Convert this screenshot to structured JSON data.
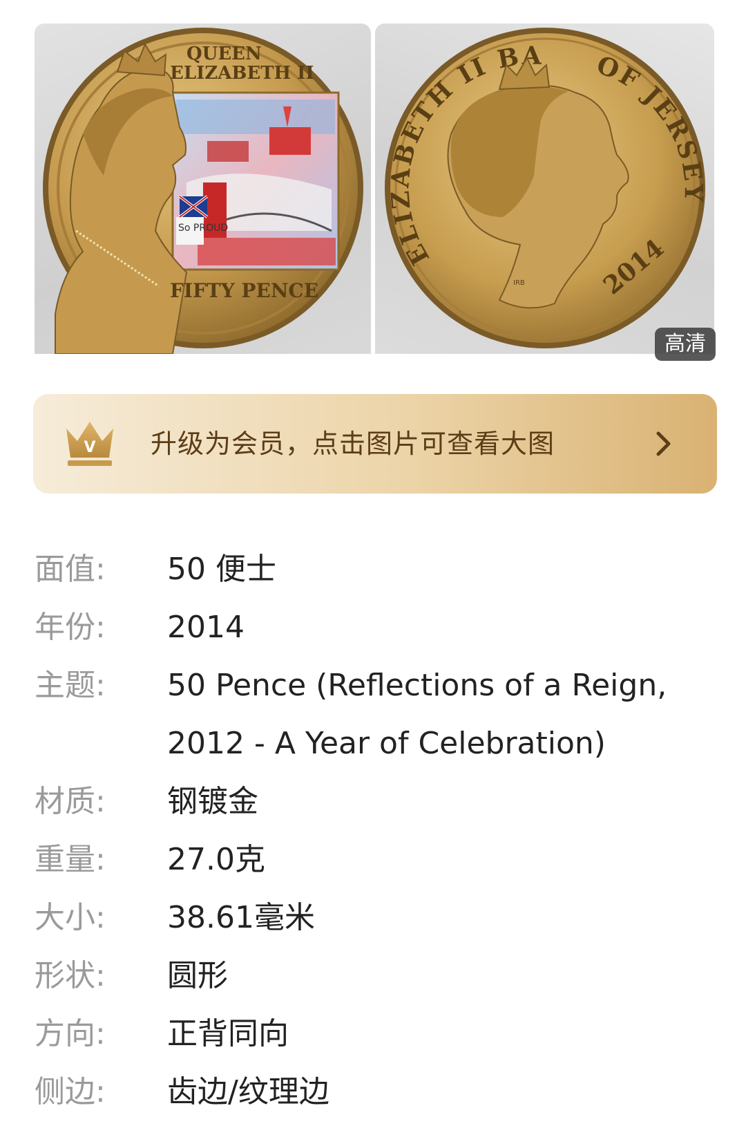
{
  "colors": {
    "gold_light": "#f6ecd9",
    "gold_dark": "#d9b273",
    "banner_text": "#5b3d17",
    "label_gray": "#9a9a9a",
    "value_dark": "#222222"
  },
  "photos": {
    "obverse": {
      "legend_top": "QUEEN",
      "legend_line2": "ELIZABETH II",
      "legend_bottom": "FIFTY PENCE",
      "sign_text": "So PROUD"
    },
    "reverse": {
      "legend_left": "ELIZABETH II BAILIWICK",
      "legend_right": "OF JERSEY",
      "year": "2014",
      "engraver": "IRB"
    },
    "hd_badge": "高清"
  },
  "vip_banner": {
    "icon": "crown-icon",
    "icon_letter": "V",
    "text": "升级为会员，点击图片可查看大图",
    "chevron": "chevron-right-icon"
  },
  "specs": [
    {
      "label": "面值:",
      "value": "50 便士"
    },
    {
      "label": "年份:",
      "value": "2014"
    },
    {
      "label": "主题:",
      "value": "50 Pence (Reflections of a Reign,",
      "value_line2": "2012 - A Year of Celebration)"
    },
    {
      "label": "材质:",
      "value": "钢镀金"
    },
    {
      "label": "重量:",
      "value": "27.0克"
    },
    {
      "label": "大小:",
      "value": "38.61毫米"
    },
    {
      "label": "形状:",
      "value": "圆形"
    },
    {
      "label": "方向:",
      "value": "正背同向"
    },
    {
      "label": "侧边:",
      "value": "齿边/纹理边"
    }
  ]
}
